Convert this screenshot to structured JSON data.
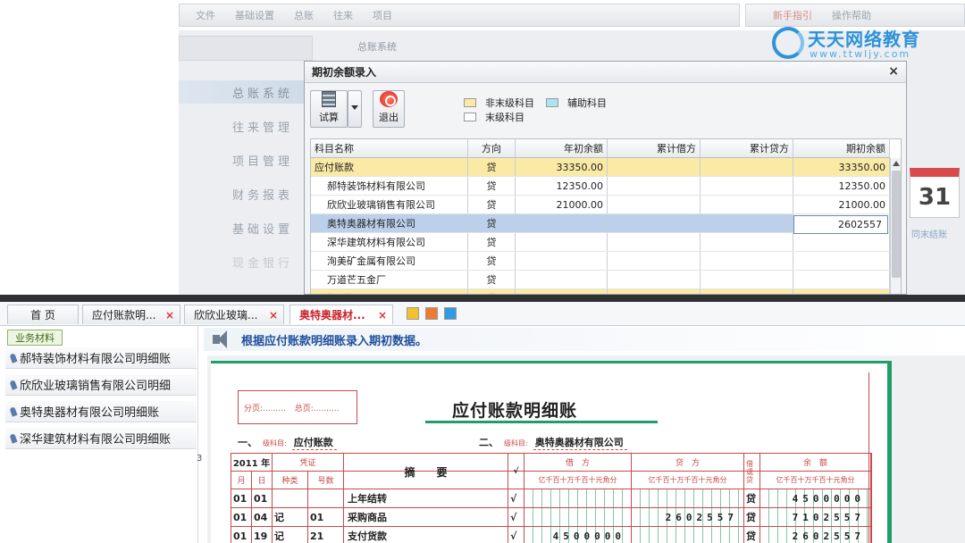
{
  "topmenu": {
    "items": [
      "文件",
      "基础设置",
      "总账",
      "往来",
      "项目"
    ],
    "guide": "新手指引",
    "help": "操作帮助"
  },
  "logo": {
    "name": "天天网络教育",
    "url": "www.ttwljy.com"
  },
  "bg": {
    "header": "总账系统",
    "nav": [
      "总账系统",
      "往来管理",
      "项目管理",
      "财务报表",
      "基础设置",
      "现金银行"
    ],
    "calendar_day": "31",
    "calendar_caption": "同末结账"
  },
  "dialog": {
    "title": "期初余额录入",
    "close": "×",
    "toolbar": {
      "calc": "试算",
      "exit": "退出"
    },
    "legend": {
      "non_leaf": "非末级科目",
      "aux": "辅助科目",
      "leaf": "末级科目"
    },
    "colors": {
      "non_leaf": "#fbeaa6",
      "aux": "#a9e6ef",
      "leaf": "#ffffff",
      "selected": "#bcd0ec"
    },
    "columns": [
      "科目名称",
      "方向",
      "年初余额",
      "累计借方",
      "累计贷方",
      "期初余额"
    ],
    "rows": [
      {
        "name": "应付账款",
        "dir": "贷",
        "begin": "33350.00",
        "debit": "",
        "credit": "",
        "opening": "33350.00",
        "type": "parent"
      },
      {
        "name": "郝特装饰材料有限公司",
        "dir": "贷",
        "begin": "12350.00",
        "debit": "",
        "credit": "",
        "opening": "12350.00",
        "type": "child"
      },
      {
        "name": "欣欣业玻璃销售有限公司",
        "dir": "贷",
        "begin": "21000.00",
        "debit": "",
        "credit": "",
        "opening": "21000.00",
        "type": "child"
      },
      {
        "name": "奥特奥器材有限公司",
        "dir": "贷",
        "begin": "",
        "debit": "",
        "credit": "",
        "opening": "",
        "type": "selected"
      },
      {
        "name": "深华建筑材料有限公司",
        "dir": "贷",
        "begin": "",
        "debit": "",
        "credit": "",
        "opening": "",
        "type": "child"
      },
      {
        "name": "洵美矿金属有限公司",
        "dir": "贷",
        "begin": "",
        "debit": "",
        "credit": "",
        "opening": "",
        "type": "child"
      },
      {
        "name": "万道芒五金厂",
        "dir": "贷",
        "begin": "",
        "debit": "",
        "credit": "",
        "opening": "",
        "type": "child"
      },
      {
        "name": "预收账款",
        "dir": "贷",
        "begin": "",
        "debit": "",
        "credit": "",
        "opening": "",
        "type": "parent"
      }
    ],
    "editing_value": "2602557"
  },
  "tabs": [
    {
      "label": "首 页",
      "closable": false
    },
    {
      "label": "应付账款明...",
      "closable": true
    },
    {
      "label": "欣欣业玻璃...",
      "closable": true
    },
    {
      "label": "奥特奥器材...",
      "closable": true,
      "active": true
    }
  ],
  "side": {
    "tab": "业务材料",
    "items": [
      "郝特装饰材料有限公司明细账",
      "欣欣业玻璃销售有限公司明细",
      "奥特奥器材有限公司明细账",
      "深华建筑材料有限公司明细账"
    ],
    "page_marker": "3"
  },
  "instruction": "根据应付账款明细账录入期初数据。",
  "ledger": {
    "pager": {
      "page": "分页:.........",
      "total": "总页:.........."
    },
    "title": "应付账款明细账",
    "sub1_prefix": "一、",
    "sub1_caption": "级科目:",
    "sub1_value": "应付账款",
    "sub2_prefix": "二、",
    "sub2_caption": "级科目:",
    "sub2_value": "奥特奥器材有限公司",
    "head": {
      "year": "2011 年",
      "voucher": "凭证",
      "summary": "摘　　要",
      "check": "√",
      "debit": "借　方",
      "credit": "贷　方",
      "dir": "借或贷",
      "balance": "余　额",
      "month": "月",
      "day": "日",
      "kind": "种类",
      "number": "号数",
      "digits": "亿千百十万千百十元角分"
    },
    "rows": [
      {
        "m": "01",
        "d": "01",
        "kind": "",
        "no": "",
        "summary": "上年结转",
        "check": "√",
        "debit": "",
        "credit": "",
        "dir": "贷",
        "balance": "4500000"
      },
      {
        "m": "01",
        "d": "04",
        "kind": "记",
        "no": "01",
        "summary": "采购商品",
        "check": "√",
        "debit": "",
        "credit": "2602557",
        "dir": "贷",
        "balance": "7102557"
      },
      {
        "m": "01",
        "d": "19",
        "kind": "记",
        "no": "21",
        "summary": "支付货款",
        "check": "√",
        "debit": "4500000",
        "credit": "",
        "dir": "贷",
        "balance": "2602557"
      }
    ]
  }
}
